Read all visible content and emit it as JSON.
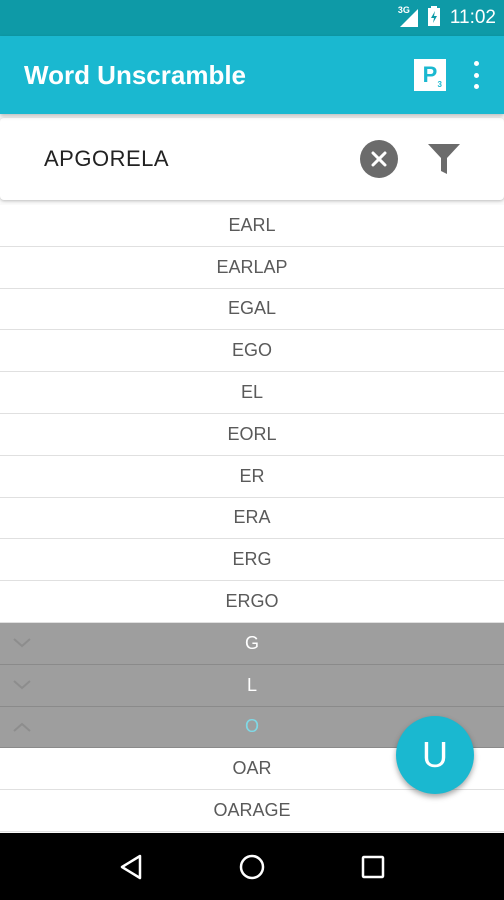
{
  "status_bar": {
    "network": "3G",
    "time": "11:02"
  },
  "app_bar": {
    "title": "Word Unscramble",
    "points_icon": {
      "letter": "P",
      "subscript": "3"
    }
  },
  "search": {
    "value": "APGORELA"
  },
  "list": [
    {
      "type": "word",
      "text": "EARL"
    },
    {
      "type": "word",
      "text": "EARLAP"
    },
    {
      "type": "word",
      "text": "EGAL"
    },
    {
      "type": "word",
      "text": "EGO"
    },
    {
      "type": "word",
      "text": "EL"
    },
    {
      "type": "word",
      "text": "EORL"
    },
    {
      "type": "word",
      "text": "ER"
    },
    {
      "type": "word",
      "text": "ERA"
    },
    {
      "type": "word",
      "text": "ERG"
    },
    {
      "type": "word",
      "text": "ERGO"
    },
    {
      "type": "section",
      "text": "G",
      "expanded": false
    },
    {
      "type": "section",
      "text": "L",
      "expanded": false
    },
    {
      "type": "section",
      "text": "O",
      "expanded": true
    },
    {
      "type": "word",
      "text": "OAR"
    },
    {
      "type": "word",
      "text": "OARAGE"
    }
  ],
  "fab": {
    "label": "U"
  },
  "colors": {
    "primary": "#1ab8d0",
    "primary_dark": "#0e9aa7",
    "section_bg": "#9e9e9e",
    "active_section_text": "#7fd9e6"
  }
}
